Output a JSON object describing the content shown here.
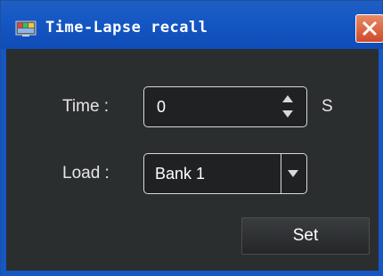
{
  "window": {
    "title": "Time-Lapse recall"
  },
  "form": {
    "time_label": "Time :",
    "time_value": "0",
    "time_unit": "S",
    "load_label": "Load :",
    "load_selected": "Bank 1"
  },
  "actions": {
    "set_label": "Set"
  },
  "colors": {
    "titlebar": "#1557c4",
    "body": "#2b2e2f",
    "close": "#d9593a",
    "text": "#e6e6e6"
  },
  "icons": {
    "app": "app-icon",
    "close": "close-icon",
    "spin_up": "spin-up-icon",
    "spin_down": "spin-down-icon",
    "dropdown": "chevron-down-icon"
  }
}
